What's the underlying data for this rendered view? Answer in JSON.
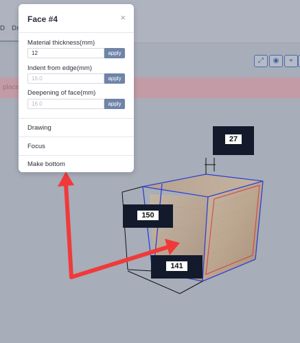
{
  "background": {
    "tabs": [
      "D",
      "Dr"
    ],
    "alert_text": "place",
    "toolbar_icons": [
      "expand-icon",
      "eye-icon",
      "focus-icon",
      "more-icon"
    ]
  },
  "popup": {
    "title": "Face #4",
    "close_symbol": "×",
    "fields": [
      {
        "label": "Material thickness(mm)",
        "value": "12",
        "placeholder": "",
        "button": "apply"
      },
      {
        "label": "Indent from edge(mm)",
        "value": "",
        "placeholder": "16.0",
        "button": "apply"
      },
      {
        "label": "Deepening of face(mm)",
        "value": "",
        "placeholder": "16.0",
        "button": "apply"
      }
    ],
    "menu": [
      "Drawing",
      "Focus",
      "Make bottom"
    ]
  },
  "dimensions": {
    "top": "27",
    "left": "150",
    "bottom": "141"
  },
  "colors": {
    "arrow": "#f03a3a",
    "edge_blue": "#2f3fd0",
    "edge_red": "#d04040",
    "apply": "#6f84a8"
  }
}
